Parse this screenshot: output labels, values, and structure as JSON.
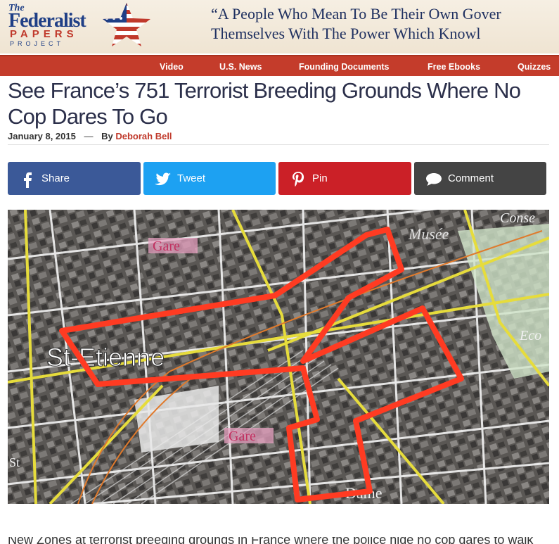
{
  "site": {
    "logo_the": "The",
    "logo_federalist": "Federalist",
    "logo_papers": "PAPERS",
    "logo_project": "PROJECT",
    "quote_line1": "“A People Who Mean To Be Their Own Gover",
    "quote_line2": "Themselves With The Power Which Knowl"
  },
  "nav": {
    "items": [
      {
        "label": "Video"
      },
      {
        "label": "U.S. News"
      },
      {
        "label": "Founding Documents"
      },
      {
        "label": "Free Ebooks"
      },
      {
        "label": "Quizzes"
      }
    ]
  },
  "article": {
    "title": "See France’s 751 Terrorist Breeding Grounds Where No Cop Dares To Go",
    "date": "January 8, 2015",
    "dash": "—",
    "by": "By",
    "author": "Deborah Bell",
    "body_start": "New Zones at terrorist breeding grounds in France where the police hide no cop dares to walk"
  },
  "share": {
    "facebook": "Share",
    "twitter": "Tweet",
    "pinterest": "Pin",
    "comment": "Comment"
  },
  "map": {
    "labels": {
      "gare_top": "Gare",
      "gare_bottom": "Gare",
      "st_etienne": "St-Etienne",
      "musee": "Musée",
      "conse": "Conse",
      "eco": "Eco",
      "dame": "Dame",
      "st": "St"
    }
  },
  "colors": {
    "nav_bg": "#c43c2b",
    "facebook": "#3b5998",
    "twitter": "#1da1f2",
    "pinterest": "#cb2027",
    "comment": "#444444",
    "author": "#c0392b",
    "zone_outline": "#ff3b22"
  },
  "icons": {
    "facebook": "facebook-icon",
    "twitter": "twitter-bird-icon",
    "pinterest": "pinterest-icon",
    "comment": "speech-bubble-icon",
    "logo_star": "flag-star-icon"
  }
}
